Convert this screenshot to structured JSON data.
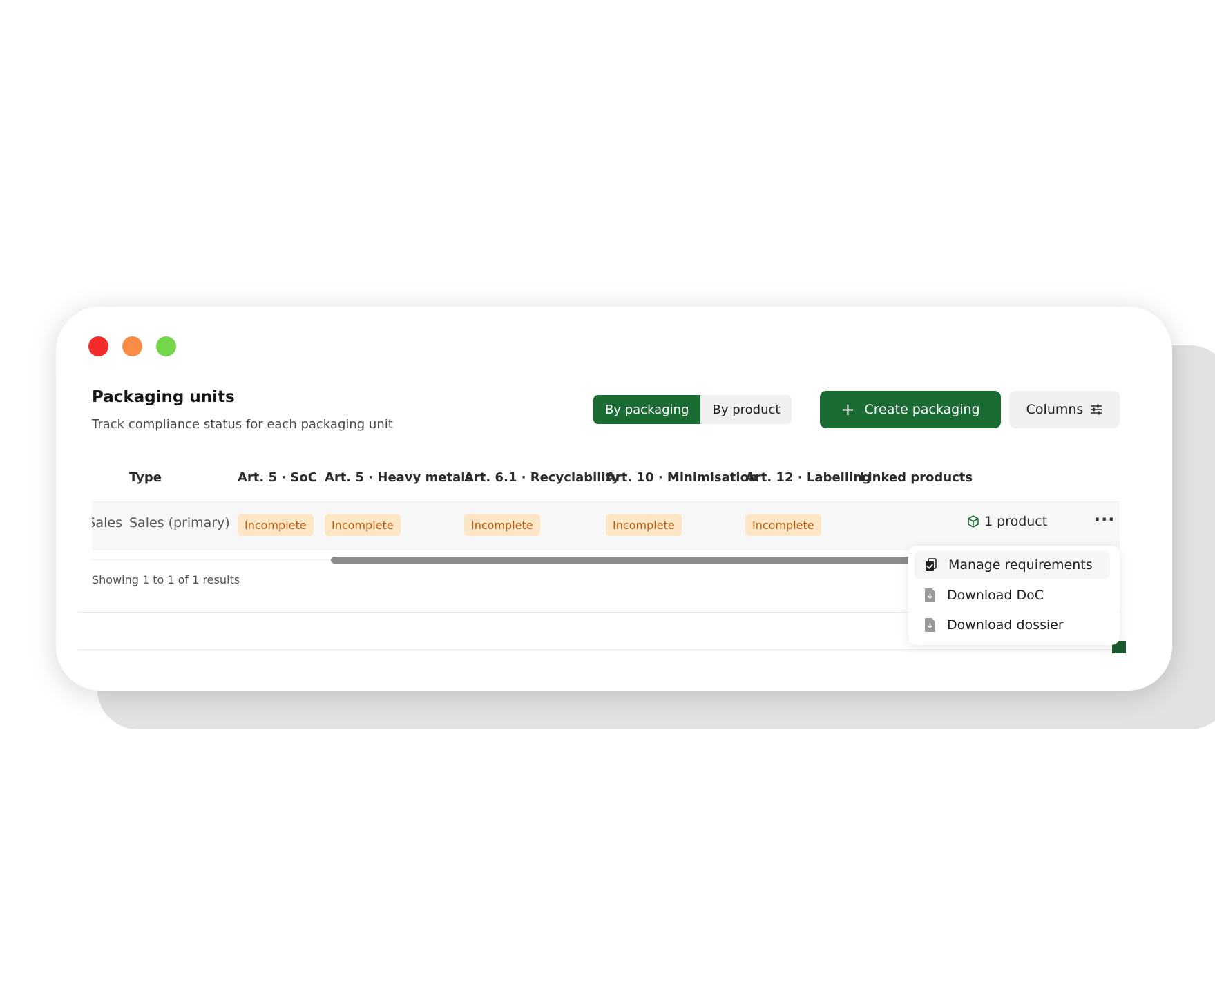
{
  "header": {
    "title": "Packaging units",
    "subtitle": "Track compliance status for each packaging unit"
  },
  "view_toggle": {
    "by_packaging": "By packaging",
    "by_product": "By product",
    "selected": "By packaging"
  },
  "actions": {
    "create_plus": "+",
    "create_label": "Create packaging",
    "columns_label": "Columns"
  },
  "table": {
    "columns": [
      "Type",
      "Art. 5 · SoC",
      "Art. 5 · Heavy metals",
      "Art. 6.1 · Recyclability",
      "Art. 10 · Minimisation",
      "Art. 12 · Labelling",
      "Linked products"
    ],
    "rows": [
      {
        "clipped_prev": "Sales",
        "type": "Sales (primary)",
        "art5_soc": "Incomplete",
        "art5_heavy": "Incomplete",
        "art61": "Incomplete",
        "art10": "Incomplete",
        "art12": "Incomplete",
        "linked": "1 product",
        "more": "···"
      }
    ]
  },
  "footer": {
    "showing": "Showing 1 to 1 of 1 results"
  },
  "row_menu": {
    "items": [
      "Manage requirements",
      "Download DoC",
      "Download dossier"
    ]
  },
  "colors": {
    "brand_green": "#1b6b34",
    "badge_bg": "#fde6c5",
    "badge_text": "#bf5a0d",
    "dot_red": "#f32b2b",
    "dot_orange": "#fb8c45",
    "dot_green": "#74d64b"
  },
  "icons": [
    "plus-icon",
    "sliders-icon",
    "package-icon",
    "more-icon",
    "clipboard-check-icon",
    "document-download-icon"
  ]
}
